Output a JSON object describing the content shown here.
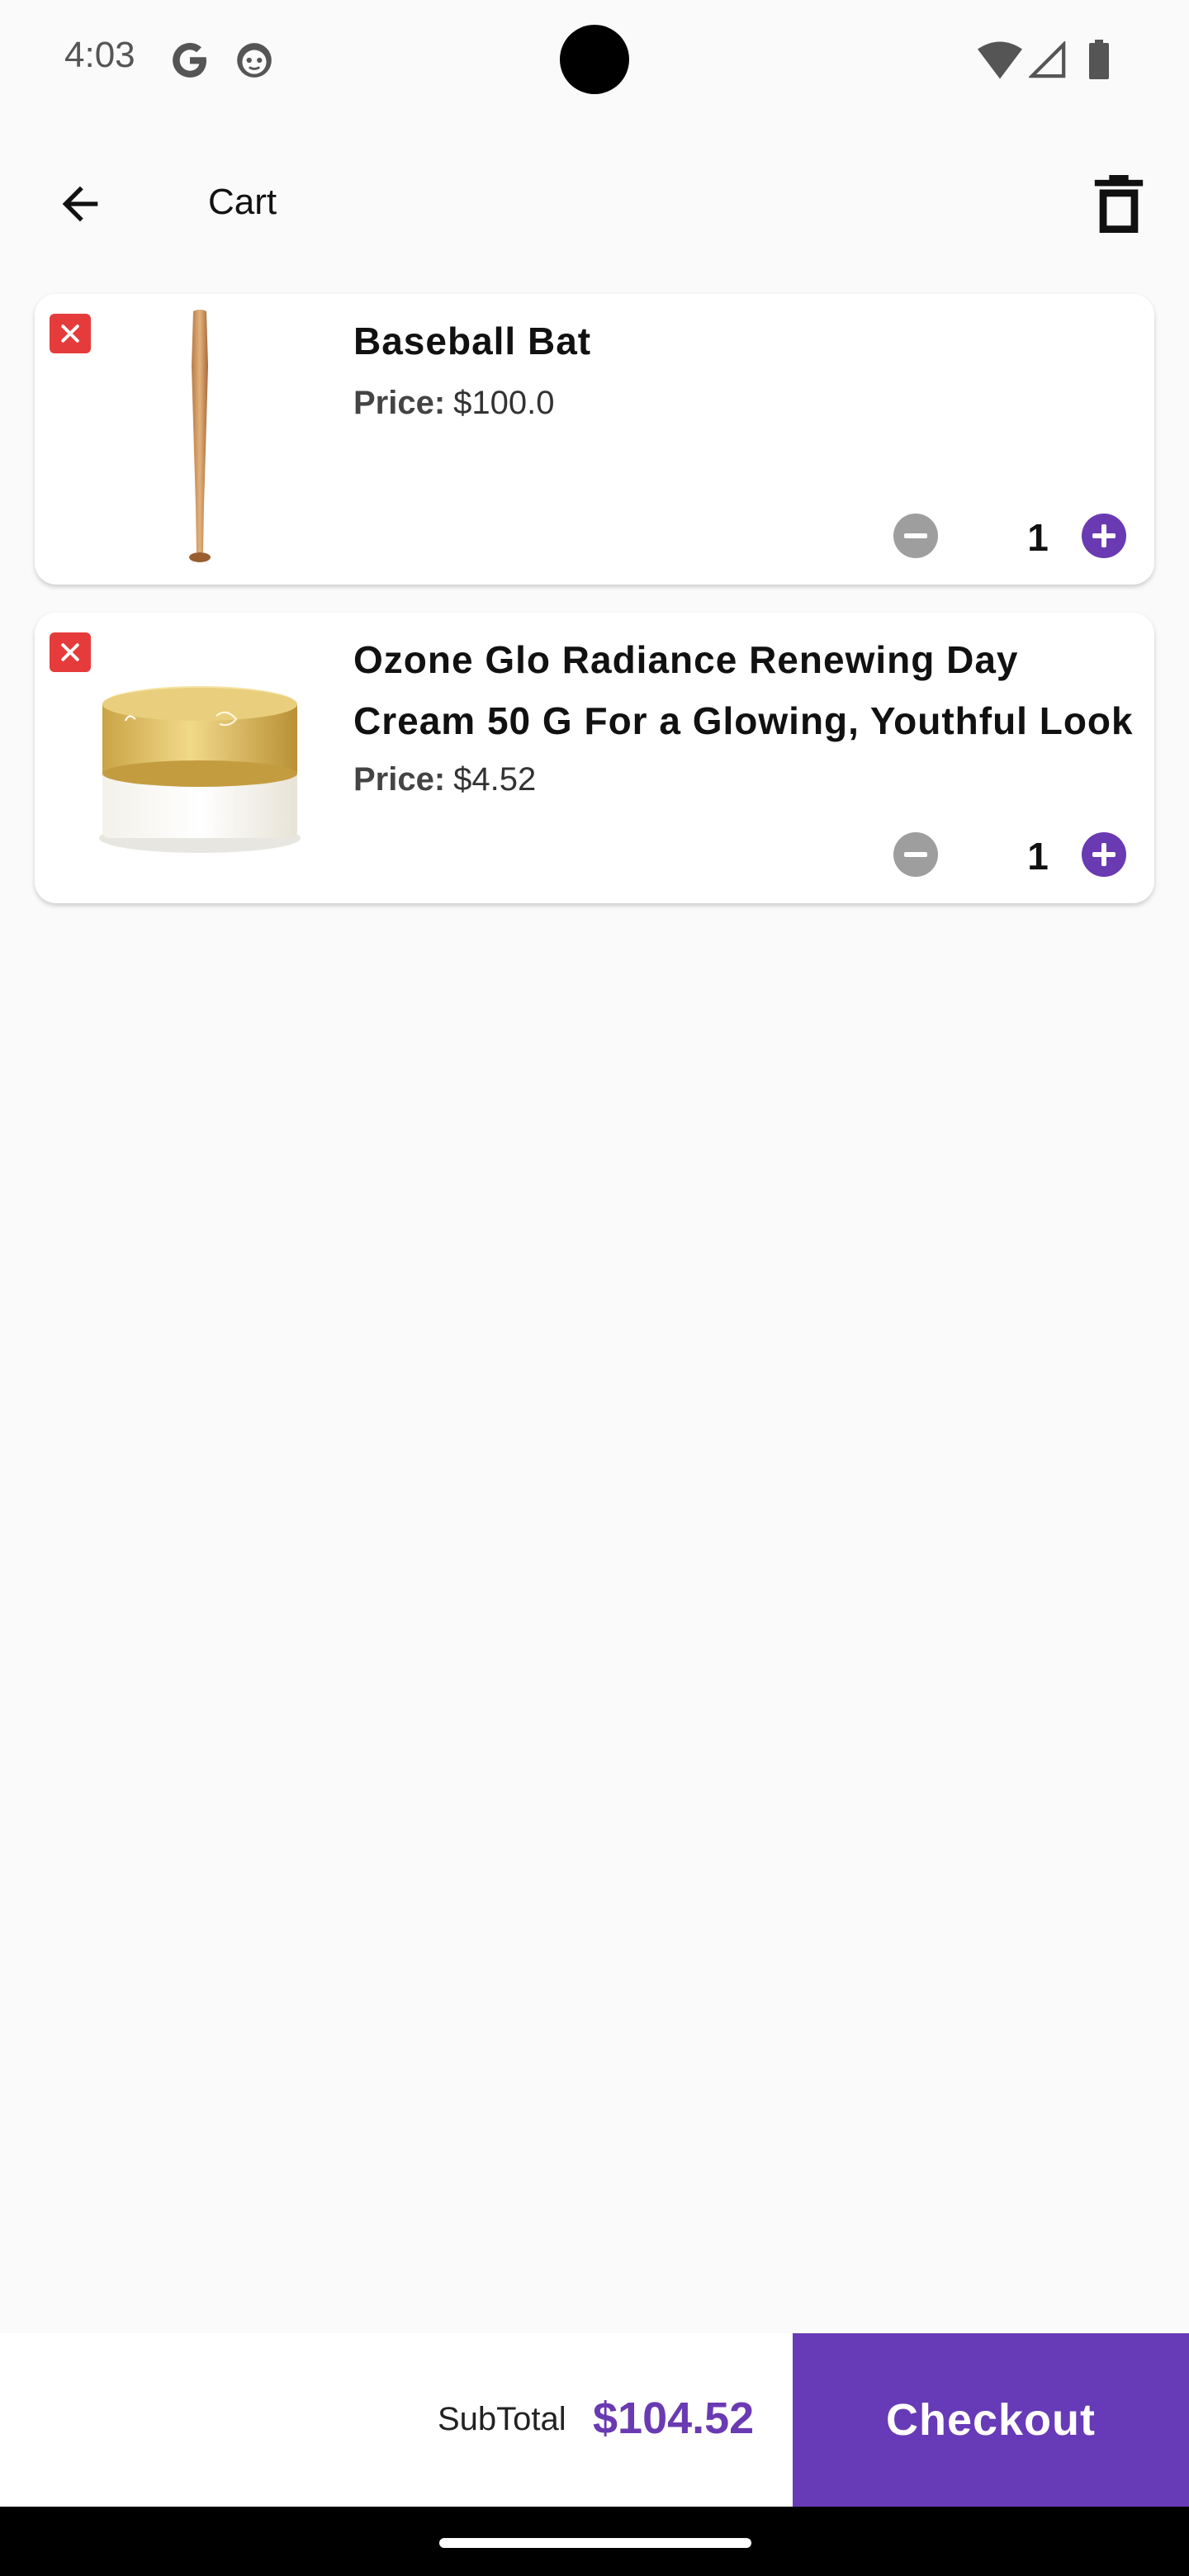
{
  "status_bar": {
    "time": "4:03",
    "icons": [
      "google-g-icon",
      "smiley-face-icon",
      "wifi-icon",
      "cell-signal-icon",
      "battery-icon"
    ]
  },
  "app_bar": {
    "title": "Cart",
    "back_icon": "arrow-left-icon",
    "delete_all_icon": "trash-icon"
  },
  "cart": {
    "items": [
      {
        "name": "Baseball Bat",
        "price_label": "Price:",
        "price": "$100.0",
        "quantity": "1",
        "image": "baseball-bat-image"
      },
      {
        "name": "Ozone Glo Radiance Renewing Day Cream 50 G For a Glowing, Youthful Look",
        "price_label": "Price:",
        "price": "$4.52",
        "quantity": "1",
        "image": "day-cream-jar-image"
      }
    ]
  },
  "footer": {
    "subtotal_label": "SubTotal",
    "subtotal_value": "$104.52",
    "checkout_label": "Checkout"
  },
  "colors": {
    "accent": "#673ab7",
    "remove": "#e53b3b",
    "minus": "#9e9e9e",
    "background": "#fafafa"
  }
}
